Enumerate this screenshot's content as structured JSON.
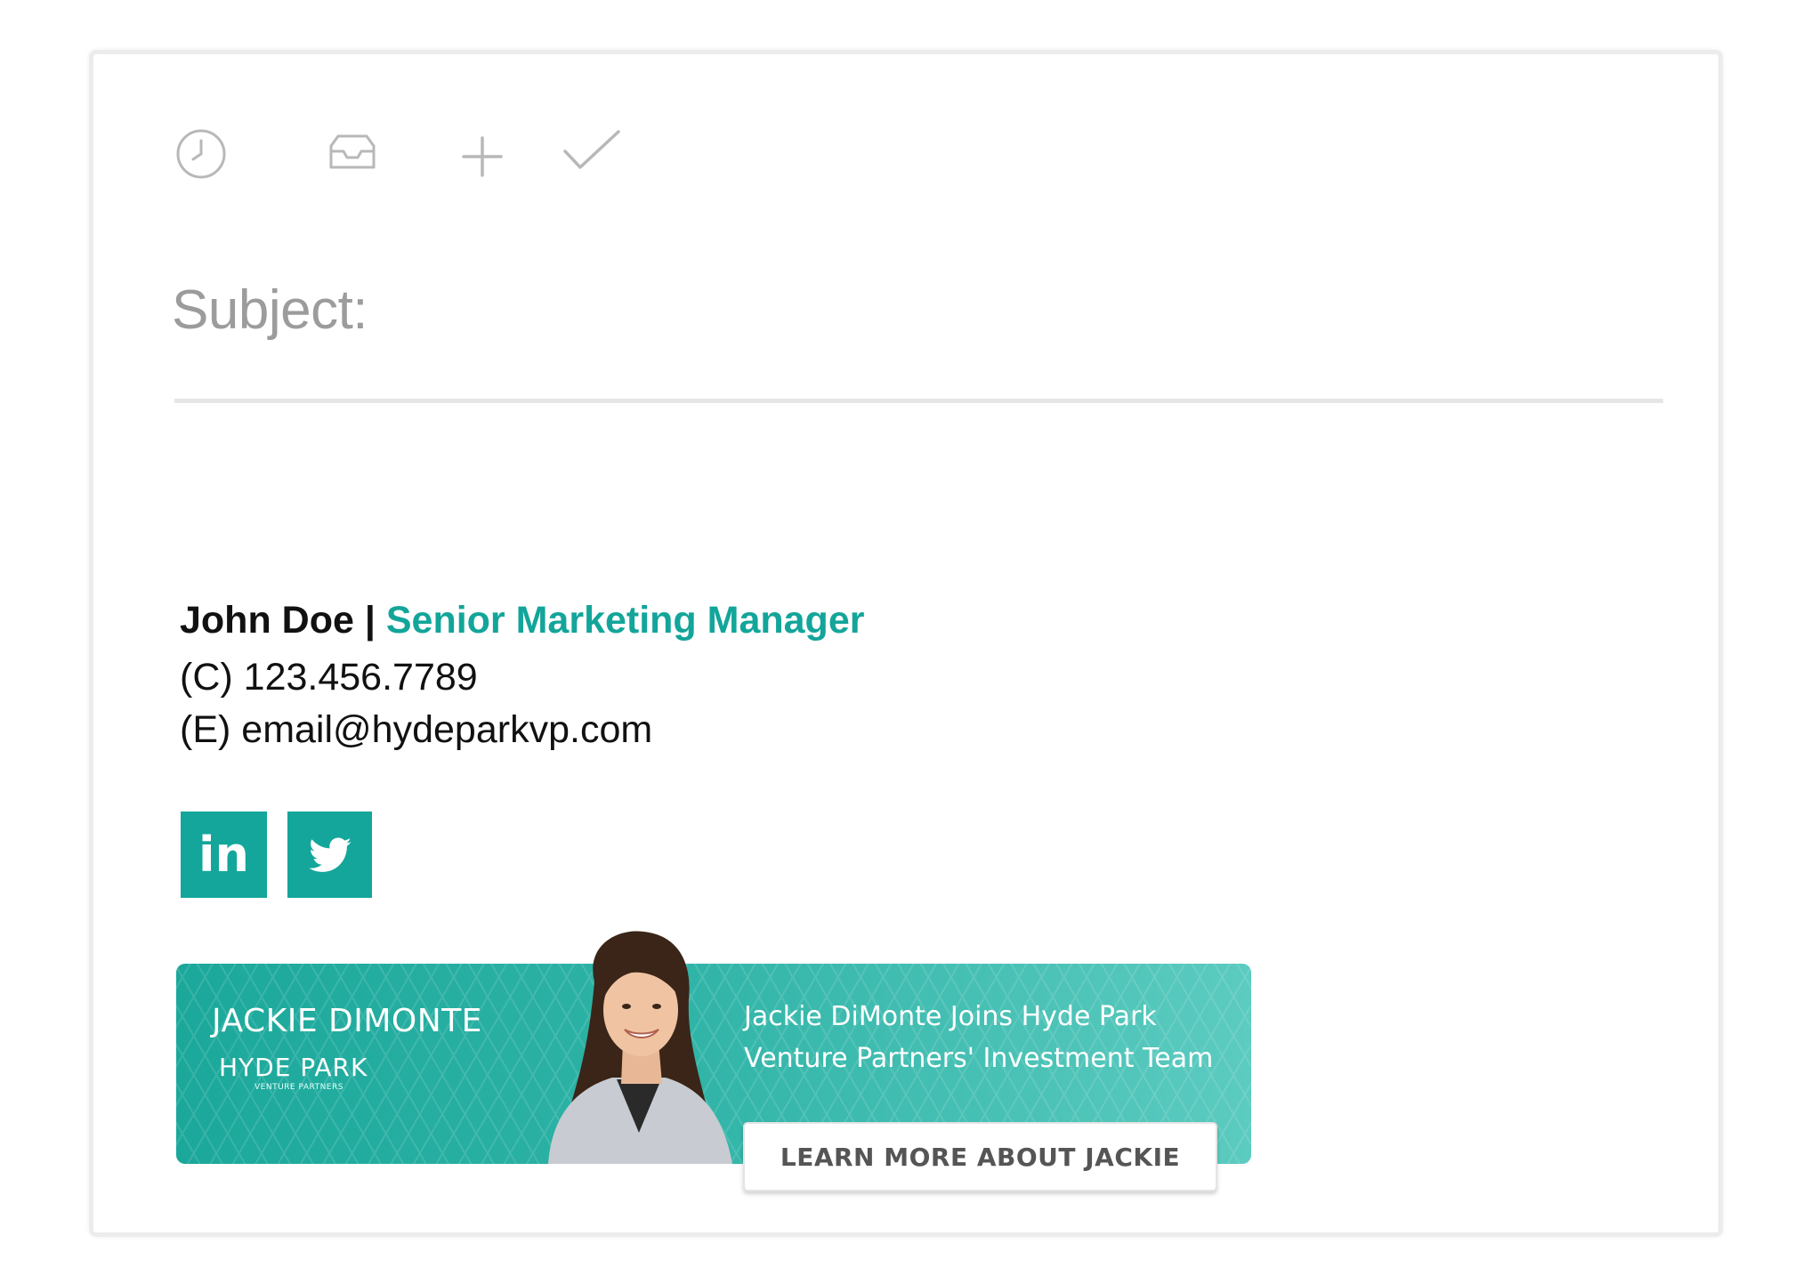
{
  "toolbar": {
    "icons": [
      "clock-icon",
      "inbox-icon",
      "plus-icon",
      "check-icon"
    ],
    "icon_color": "#b8b8b8"
  },
  "compose": {
    "subject_label": "Subject:"
  },
  "signature": {
    "name": "John Doe",
    "separator": " | ",
    "title": "Senior Marketing Manager",
    "title_color": "#13a59a",
    "phone_prefix": "(C)",
    "phone": "123.456.7789",
    "email_prefix": "(E)",
    "email": "email@hydeparkvp.com",
    "social": {
      "color": "#14a69b",
      "linkedin_label": "in",
      "twitter_icon": "twitter-bird-icon"
    },
    "banner": {
      "name": "JACKIE DIMONTE",
      "logo_text": "HYDE PARK",
      "logo_sub": "VENTURE PARTNERS",
      "headline_line1": "Jackie DiMonte Joins Hyde Park",
      "headline_line2": "Venture Partners' Investment Team",
      "cta_label": "LEARN MORE ABOUT JACKIE",
      "color": "#1ba89b"
    }
  }
}
